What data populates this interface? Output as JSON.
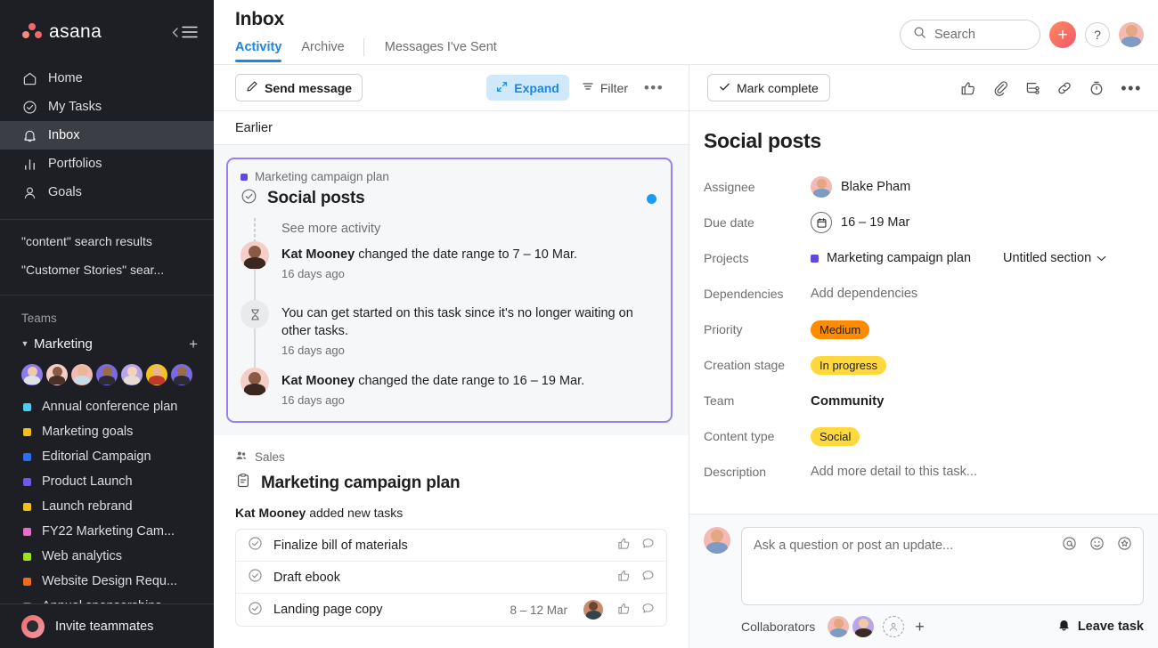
{
  "brand": {
    "name": "asana",
    "accent_blue": "#1b86e3",
    "accent_purple": "#9a7ff0",
    "sidebar_bg": "#1e1f25"
  },
  "sidebar": {
    "collapse_icon": "collapse-menu-icon",
    "nav": [
      {
        "label": "Home",
        "icon": "home-icon",
        "active": false
      },
      {
        "label": "My Tasks",
        "icon": "check-circle-icon",
        "active": false
      },
      {
        "label": "Inbox",
        "icon": "bell-icon",
        "active": true
      },
      {
        "label": "Portfolios",
        "icon": "bar-chart-icon",
        "active": false
      },
      {
        "label": "Goals",
        "icon": "goal-icon",
        "active": false
      }
    ],
    "saved_searches": [
      {
        "label": "\"content\" search results"
      },
      {
        "label": "\"Customer Stories\" sear..."
      }
    ],
    "teams_heading": "Teams",
    "team": {
      "name": "Marketing",
      "add_label": "+",
      "member_count": 7
    },
    "projects": [
      {
        "label": "Annual conference plan",
        "color": "#4ecbf2"
      },
      {
        "label": "Marketing goals",
        "color": "#f1bd20"
      },
      {
        "label": "Editorial Campaign",
        "color": "#2a6ff0"
      },
      {
        "label": "Product Launch",
        "color": "#6f5ae6"
      },
      {
        "label": "Launch rebrand",
        "color": "#f1bd20"
      },
      {
        "label": "FY22 Marketing Cam...",
        "color": "#e56ecd"
      },
      {
        "label": "Web analytics",
        "color": "#9ee21f"
      },
      {
        "label": "Website Design Requ...",
        "color": "#f06a20"
      },
      {
        "label": "Annual sponsorships",
        "color": "#13c0a5"
      }
    ],
    "invite": {
      "label": "Invite teammates",
      "icon": "invite-icon"
    }
  },
  "header": {
    "title": "Inbox",
    "tabs": [
      {
        "label": "Activity",
        "active": true
      },
      {
        "label": "Archive",
        "active": false
      },
      {
        "label": "Messages I've Sent",
        "active": false
      }
    ],
    "search": {
      "placeholder": "Search",
      "icon": "search-icon"
    },
    "create_button": {
      "label": "+",
      "icon": "plus-icon"
    },
    "help_button": {
      "label": "?",
      "icon": "question-mark-icon"
    },
    "profile": {
      "icon": "avatar"
    }
  },
  "inbox": {
    "toolbar": {
      "send_message": "Send message",
      "expand": "Expand",
      "filter": "Filter",
      "more": "•••"
    },
    "group_heading": "Earlier",
    "card": {
      "project": "Marketing campaign plan",
      "project_color": "#5f49e0",
      "title": "Social posts",
      "unread": true,
      "see_more": "See more activity",
      "activity": [
        {
          "actor": "Kat Mooney",
          "text": " changed the date range to 7 – 10 Mar.",
          "time": "16 days ago",
          "icon": "avatar"
        },
        {
          "actor": "",
          "text": "You can get started on this task since it's no longer waiting on other tasks.",
          "time": "16 days ago",
          "icon": "hourglass-icon"
        },
        {
          "actor": "Kat Mooney",
          "text": " changed the date range to 16 – 19 Mar.",
          "time": "16 days ago",
          "icon": "avatar"
        }
      ]
    },
    "next_item": {
      "team": "Sales",
      "project": "Marketing campaign plan",
      "subtitle_actor": "Kat Mooney",
      "subtitle_rest": " added new tasks",
      "tasks": [
        {
          "name": "Finalize bill of materials",
          "date": "",
          "has_avatar": false
        },
        {
          "name": "Draft ebook",
          "date": "",
          "has_avatar": false
        },
        {
          "name": "Landing page copy",
          "date": "8 – 12 Mar",
          "has_avatar": true
        }
      ]
    }
  },
  "detail": {
    "toolbar": {
      "mark_complete": "Mark complete",
      "icons": [
        "like-icon",
        "attachment-icon",
        "subtask-icon",
        "link-icon",
        "timer-icon",
        "more-icon"
      ]
    },
    "title": "Social posts",
    "fields": [
      {
        "label": "Assignee",
        "type": "person",
        "value": "Blake Pham"
      },
      {
        "label": "Due date",
        "type": "date",
        "value": "16 – 19 Mar"
      },
      {
        "label": "Projects",
        "type": "project",
        "value": "Marketing campaign plan",
        "section": "Untitled section",
        "color": "#5f49e0"
      },
      {
        "label": "Dependencies",
        "type": "link",
        "value": "Add dependencies"
      },
      {
        "label": "Priority",
        "type": "pill",
        "value": "Medium",
        "pill_bg": "#ff8c00"
      },
      {
        "label": "Creation stage",
        "type": "pill",
        "value": "In progress",
        "pill_bg": "#ffd83d"
      },
      {
        "label": "Team",
        "type": "text",
        "value": "Community"
      },
      {
        "label": "Content type",
        "type": "pill",
        "value": "Social",
        "pill_bg": "#ffd83d"
      },
      {
        "label": "Description",
        "type": "link",
        "value": "Add more detail to this task..."
      }
    ],
    "comment": {
      "placeholder": "Ask a question or post an update...",
      "tools": [
        "mention-icon",
        "emoji-icon",
        "sticker-icon"
      ]
    },
    "collaborators": {
      "label": "Collaborators",
      "count": 2,
      "add_label": "+"
    },
    "leave_task": "Leave task"
  }
}
